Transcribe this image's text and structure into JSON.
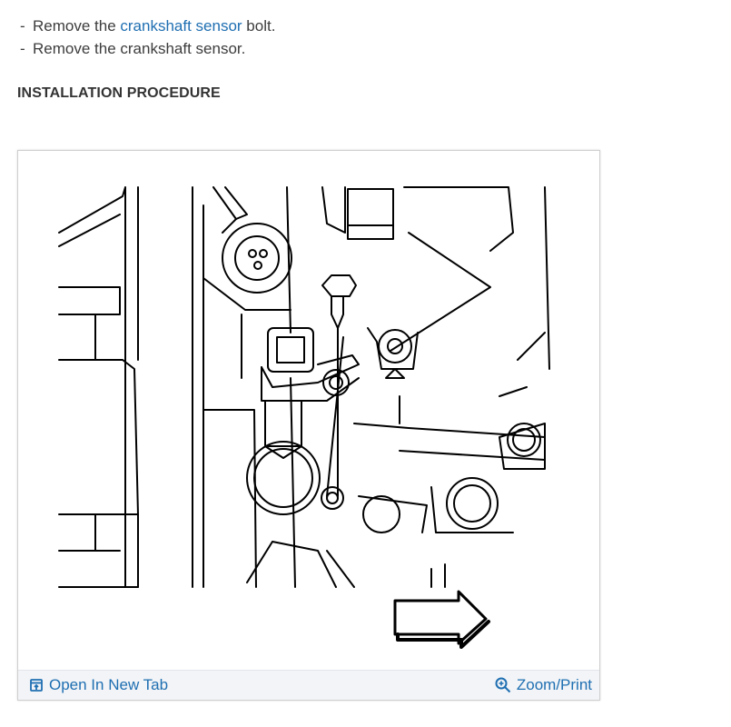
{
  "steps": [
    {
      "prefix": "Remove the ",
      "link": "crankshaft sensor",
      "suffix": " bolt."
    },
    {
      "prefix": "Remove the crankshaft sensor.",
      "link": "",
      "suffix": ""
    }
  ],
  "section_heading": "INSTALLATION PROCEDURE",
  "figure": {
    "open_tab_label": "Open In New Tab",
    "zoom_label": "Zoom/Print",
    "open_tab_icon": "open-in-new-tab-icon",
    "zoom_icon": "zoom-in-icon"
  },
  "colors": {
    "link": "#1f6fb2",
    "toolbar_bg": "#f2f4f7"
  }
}
